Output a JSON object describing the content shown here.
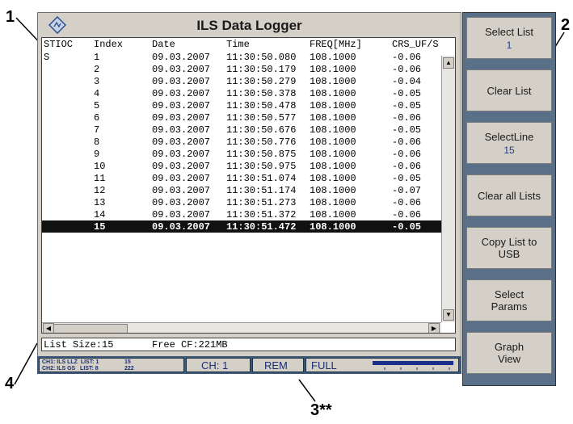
{
  "callouts": {
    "c1": "1",
    "c2": "2",
    "c3": "3**",
    "c4": "4"
  },
  "window": {
    "title": "ILS Data Logger"
  },
  "table": {
    "headers": [
      "STIOC",
      "Index",
      "Date",
      "Time",
      "FREQ[MHz]",
      "CRS_UF/S"
    ],
    "rows": [
      {
        "stioc": "S",
        "index": "1",
        "date": "09.03.2007",
        "time": "11:30:50.080",
        "freq": "108.1000",
        "crs": "-0.06"
      },
      {
        "stioc": "",
        "index": "2",
        "date": "09.03.2007",
        "time": "11:30:50.179",
        "freq": "108.1000",
        "crs": "-0.06"
      },
      {
        "stioc": "",
        "index": "3",
        "date": "09.03.2007",
        "time": "11:30:50.279",
        "freq": "108.1000",
        "crs": "-0.04"
      },
      {
        "stioc": "",
        "index": "4",
        "date": "09.03.2007",
        "time": "11:30:50.378",
        "freq": "108.1000",
        "crs": "-0.05"
      },
      {
        "stioc": "",
        "index": "5",
        "date": "09.03.2007",
        "time": "11:30:50.478",
        "freq": "108.1000",
        "crs": "-0.05"
      },
      {
        "stioc": "",
        "index": "6",
        "date": "09.03.2007",
        "time": "11:30:50.577",
        "freq": "108.1000",
        "crs": "-0.06"
      },
      {
        "stioc": "",
        "index": "7",
        "date": "09.03.2007",
        "time": "11:30:50.676",
        "freq": "108.1000",
        "crs": "-0.05"
      },
      {
        "stioc": "",
        "index": "8",
        "date": "09.03.2007",
        "time": "11:30:50.776",
        "freq": "108.1000",
        "crs": "-0.06"
      },
      {
        "stioc": "",
        "index": "9",
        "date": "09.03.2007",
        "time": "11:30:50.875",
        "freq": "108.1000",
        "crs": "-0.06"
      },
      {
        "stioc": "",
        "index": "10",
        "date": "09.03.2007",
        "time": "11:30:50.975",
        "freq": "108.1000",
        "crs": "-0.06"
      },
      {
        "stioc": "",
        "index": "11",
        "date": "09.03.2007",
        "time": "11:30:51.074",
        "freq": "108.1000",
        "crs": "-0.05"
      },
      {
        "stioc": "",
        "index": "12",
        "date": "09.03.2007",
        "time": "11:30:51.174",
        "freq": "108.1000",
        "crs": "-0.07"
      },
      {
        "stioc": "",
        "index": "13",
        "date": "09.03.2007",
        "time": "11:30:51.273",
        "freq": "108.1000",
        "crs": "-0.06"
      },
      {
        "stioc": "",
        "index": "14",
        "date": "09.03.2007",
        "time": "11:30:51.372",
        "freq": "108.1000",
        "crs": "-0.06"
      },
      {
        "stioc": "",
        "index": "15",
        "date": "09.03.2007",
        "time": "11:30:51.472",
        "freq": "108.1000",
        "crs": "-0.05"
      }
    ],
    "selected_index": "15"
  },
  "status": {
    "list_size": "List Size:15",
    "free": "Free CF:221MB"
  },
  "infobar": {
    "ch1_line": "CH1: ILS LLZ  LIST: 1",
    "ch2_line": "CH2: ILS GS   LIST: 8",
    "ch1_val": "15",
    "ch2_val": "222",
    "channel": "CH: 1",
    "rem": "REM",
    "full": "FULL"
  },
  "softkeys": [
    {
      "label": "Select List",
      "value": "1"
    },
    {
      "label": "Clear List",
      "value": ""
    },
    {
      "label": "SelectLine",
      "value": "15"
    },
    {
      "label": "Clear all Lists",
      "value": ""
    },
    {
      "label": "Copy List to USB",
      "value": ""
    },
    {
      "label": "Select Params",
      "value": ""
    },
    {
      "label": "Graph View",
      "value": ""
    }
  ],
  "colors": {
    "selected_row": "#111111",
    "softkey_value": "#1f3c8c",
    "panel_bg": "#5a7088"
  }
}
